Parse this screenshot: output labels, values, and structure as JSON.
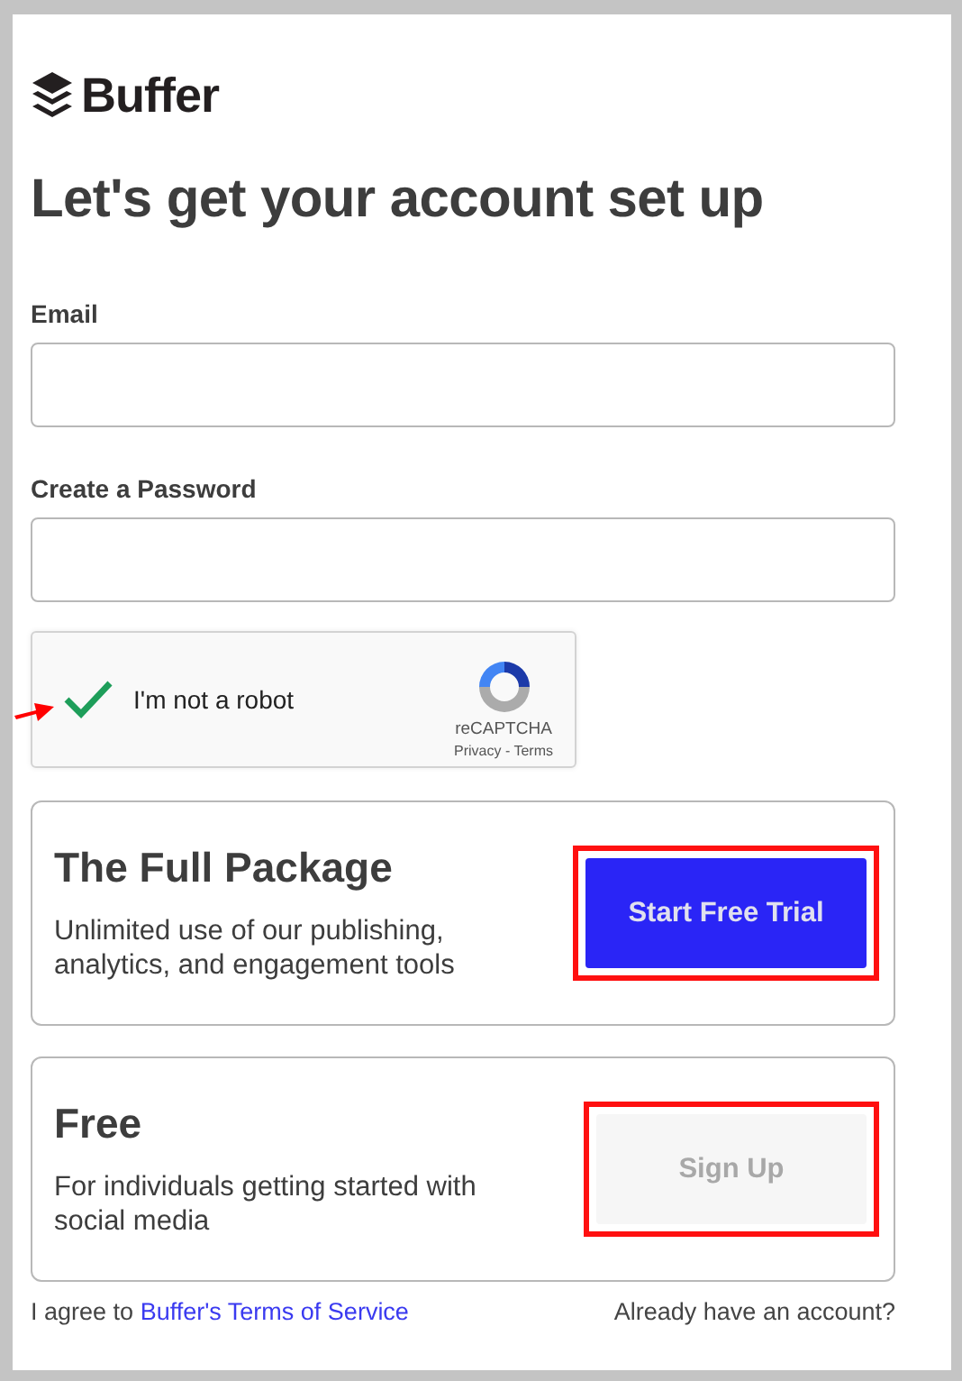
{
  "brand": {
    "name": "Buffer"
  },
  "heading": "Let's get your account set up",
  "fields": [
    {
      "label": "Email"
    },
    {
      "label": "Create a Password"
    }
  ],
  "captcha": {
    "label": "I'm not a robot",
    "checked": true,
    "pointed_at": true,
    "brand": "reCAPTCHA",
    "links": [
      "Privacy",
      "Terms"
    ],
    "separator": "-"
  },
  "plans": [
    {
      "title": "The Full Package",
      "description": "Unlimited use of our publishing, analytics, and engagement tools",
      "button": "Start Free Trial",
      "kind": "primary",
      "highlighted": true
    },
    {
      "title": "Free",
      "description": "For individuals getting started with social media",
      "button": "Sign Up",
      "kind": "secondary",
      "highlighted": true
    }
  ],
  "footer": {
    "agree": "I agree to",
    "terms_link": "Buffer's Terms of Service",
    "login": "Already have an account?"
  }
}
